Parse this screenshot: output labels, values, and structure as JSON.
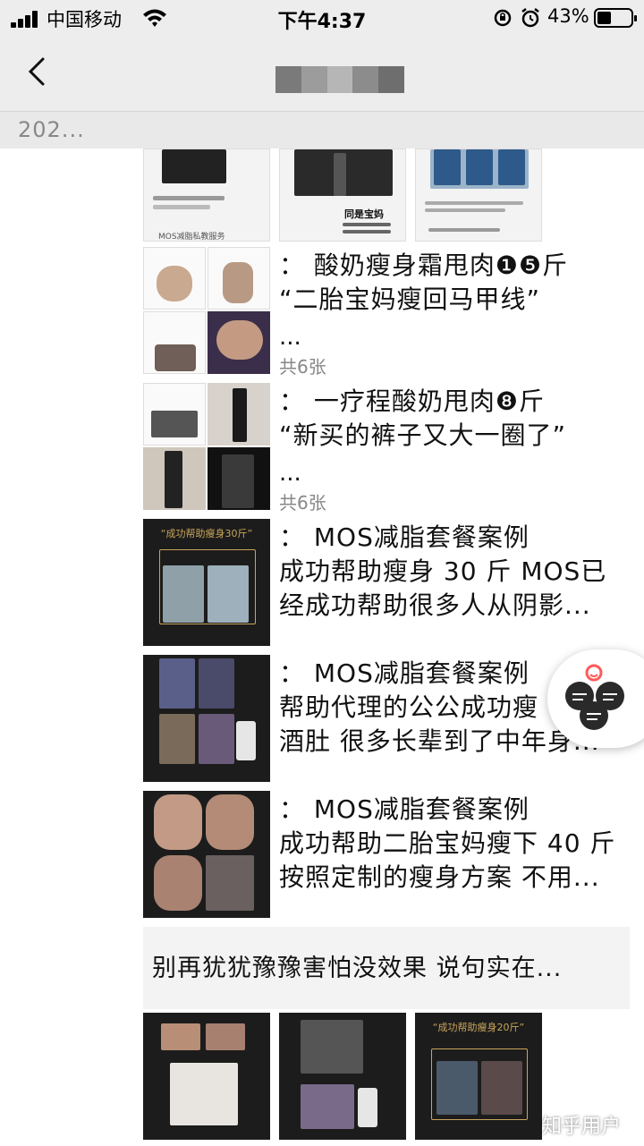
{
  "status_bar": {
    "carrier": "中国移动",
    "time": "下午4:37",
    "battery_percent": "43%",
    "battery_level": 0.43
  },
  "nav": {
    "back_icon": "chevron-left-icon",
    "title_blurred": true
  },
  "date_header": "202...",
  "posts": [
    {
      "line1": "：  酸奶瘦身霜甩肉❶❺斤",
      "line2": "“二胎宝妈瘦回马甲线”",
      "line3": "...",
      "count": "共6张"
    },
    {
      "line1": "：  一疗程酸奶甩肉❽斤",
      "line2": "“新买的裤子又大一圈了”",
      "line3": "...",
      "count": "共6张"
    },
    {
      "line1": "：  MOS减脂套餐案例",
      "line2": "成功帮助瘦身 30 斤 MOS已",
      "line3": "经成功帮助很多人从阴影..."
    },
    {
      "line1": "：  MOS减脂套餐案例",
      "line2": "帮助代理的公公成功瘦",
      "line3": "酒肚 很多长辈到了中年身..."
    },
    {
      "line1": "：  MOS减脂套餐案例",
      "line2": "成功帮助二胎宝妈瘦下 40 斤",
      "line3": " 按照定制的瘦身方案 不用..."
    }
  ],
  "thumb_captions": {
    "success30": "“成功帮助瘦身30斤”",
    "success20": "“成功帮助瘦身20斤”",
    "mom_top": "同是宝妈",
    "mos_service": "MOS减脂私教服务"
  },
  "share_card_text": "别再犹犹豫豫害怕没效果 说句实在...",
  "watermark": "知乎用户",
  "colors": {
    "nav_bg": "#ededed",
    "date_bg": "#e9e9e9",
    "thumb_dark": "#1c1c1c",
    "caption_gold": "#c9a55b"
  }
}
